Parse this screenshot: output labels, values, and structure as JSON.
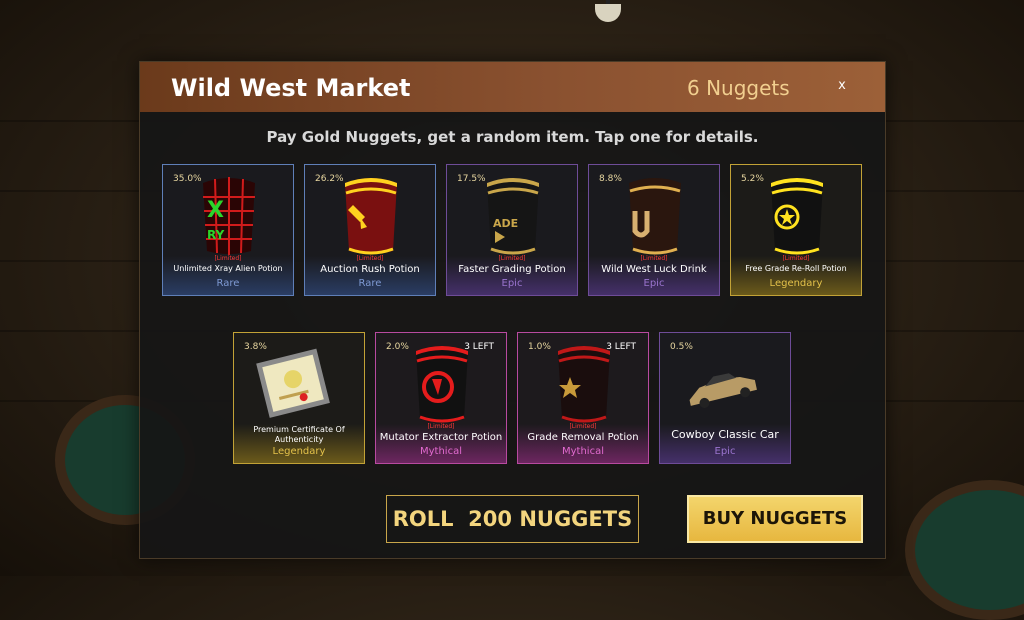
{
  "market": {
    "title": "Wild West Market",
    "nuggets_balance": "6 Nuggets",
    "close_label": "x",
    "subtitle": "Pay Gold Nuggets, get a random item. Tap one for details."
  },
  "items": [
    {
      "chance": "35.0%",
      "limited": "[Limited]",
      "name": "Unlimited Xray Alien Potion",
      "rarity": "Rare",
      "left": "",
      "icon": "xray-potion-icon"
    },
    {
      "chance": "26.2%",
      "limited": "[Limited]",
      "name": "Auction Rush Potion",
      "rarity": "Rare",
      "left": "",
      "icon": "auction-potion-icon"
    },
    {
      "chance": "17.5%",
      "limited": "[Limited]",
      "name": "Faster Grading Potion",
      "rarity": "Epic",
      "left": "",
      "icon": "grading-potion-icon"
    },
    {
      "chance": "8.8%",
      "limited": "[Limited]",
      "name": "Wild West Luck Drink",
      "rarity": "Epic",
      "left": "",
      "icon": "luck-drink-icon"
    },
    {
      "chance": "5.2%",
      "limited": "[Limited]",
      "name": "Free Grade Re-Roll Potion",
      "rarity": "Legendary",
      "left": "",
      "icon": "reroll-potion-icon"
    },
    {
      "chance": "3.8%",
      "limited": "",
      "name": "Premium Certificate Of Authenticity",
      "rarity": "Legendary",
      "left": "",
      "icon": "certificate-icon"
    },
    {
      "chance": "2.0%",
      "limited": "[Limited]",
      "name": "Mutator Extractor Potion",
      "rarity": "Mythical",
      "left": "3 LEFT",
      "icon": "mutator-potion-icon"
    },
    {
      "chance": "1.0%",
      "limited": "[Limited]",
      "name": "Grade Removal Potion",
      "rarity": "Mythical",
      "left": "3 LEFT",
      "icon": "grade-removal-potion-icon"
    },
    {
      "chance": "0.5%",
      "limited": "",
      "name": "Cowboy Classic Car",
      "rarity": "Epic",
      "left": "",
      "icon": "classic-car-icon"
    }
  ],
  "actions": {
    "roll_label": "ROLL  200 NUGGETS",
    "buy_label": "BUY NUGGETS"
  },
  "colors": {
    "rare": "#5f7fb8",
    "epic": "#6e4c98",
    "legendary": "#c2a236",
    "mythical": "#b84aa0",
    "header": "#8a5130",
    "gold": "#f3d56c"
  }
}
